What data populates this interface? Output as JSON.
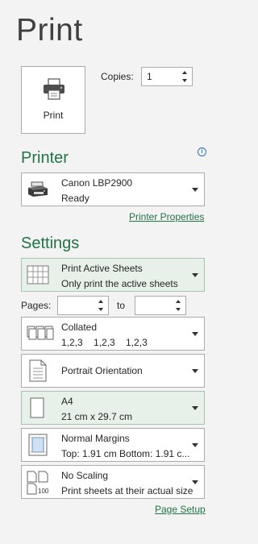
{
  "title": "Print",
  "print_button": {
    "label": "Print",
    "icon": "printer-icon"
  },
  "copies": {
    "label": "Copies:",
    "value": "1"
  },
  "printer_section": {
    "heading": "Printer",
    "selected": {
      "name": "Canon LBP2900",
      "status": "Ready",
      "icon": "printer-device-icon"
    },
    "properties_link": "Printer Properties"
  },
  "settings_section": {
    "heading": "Settings",
    "what_to_print": {
      "line1": "Print Active Sheets",
      "line2": "Only print the active sheets"
    },
    "pages": {
      "label": "Pages:",
      "from": "",
      "to_label": "to",
      "to": ""
    },
    "collation": {
      "line1": "Collated",
      "line2": "1,2,3    1,2,3    1,2,3"
    },
    "orientation": {
      "label": "Portrait Orientation"
    },
    "paper_size": {
      "line1": "A4",
      "line2": "21 cm x 29.7 cm"
    },
    "margins": {
      "line1": "Normal Margins",
      "line2": "Top: 1.91 cm Bottom: 1.91 c..."
    },
    "scaling": {
      "line1": "No Scaling",
      "line2": "Print sheets at their actual size",
      "icon_text": "100"
    },
    "page_setup_link": "Page Setup"
  },
  "colors": {
    "accent": "#217346",
    "selected_bg": "#e7f1ea"
  }
}
